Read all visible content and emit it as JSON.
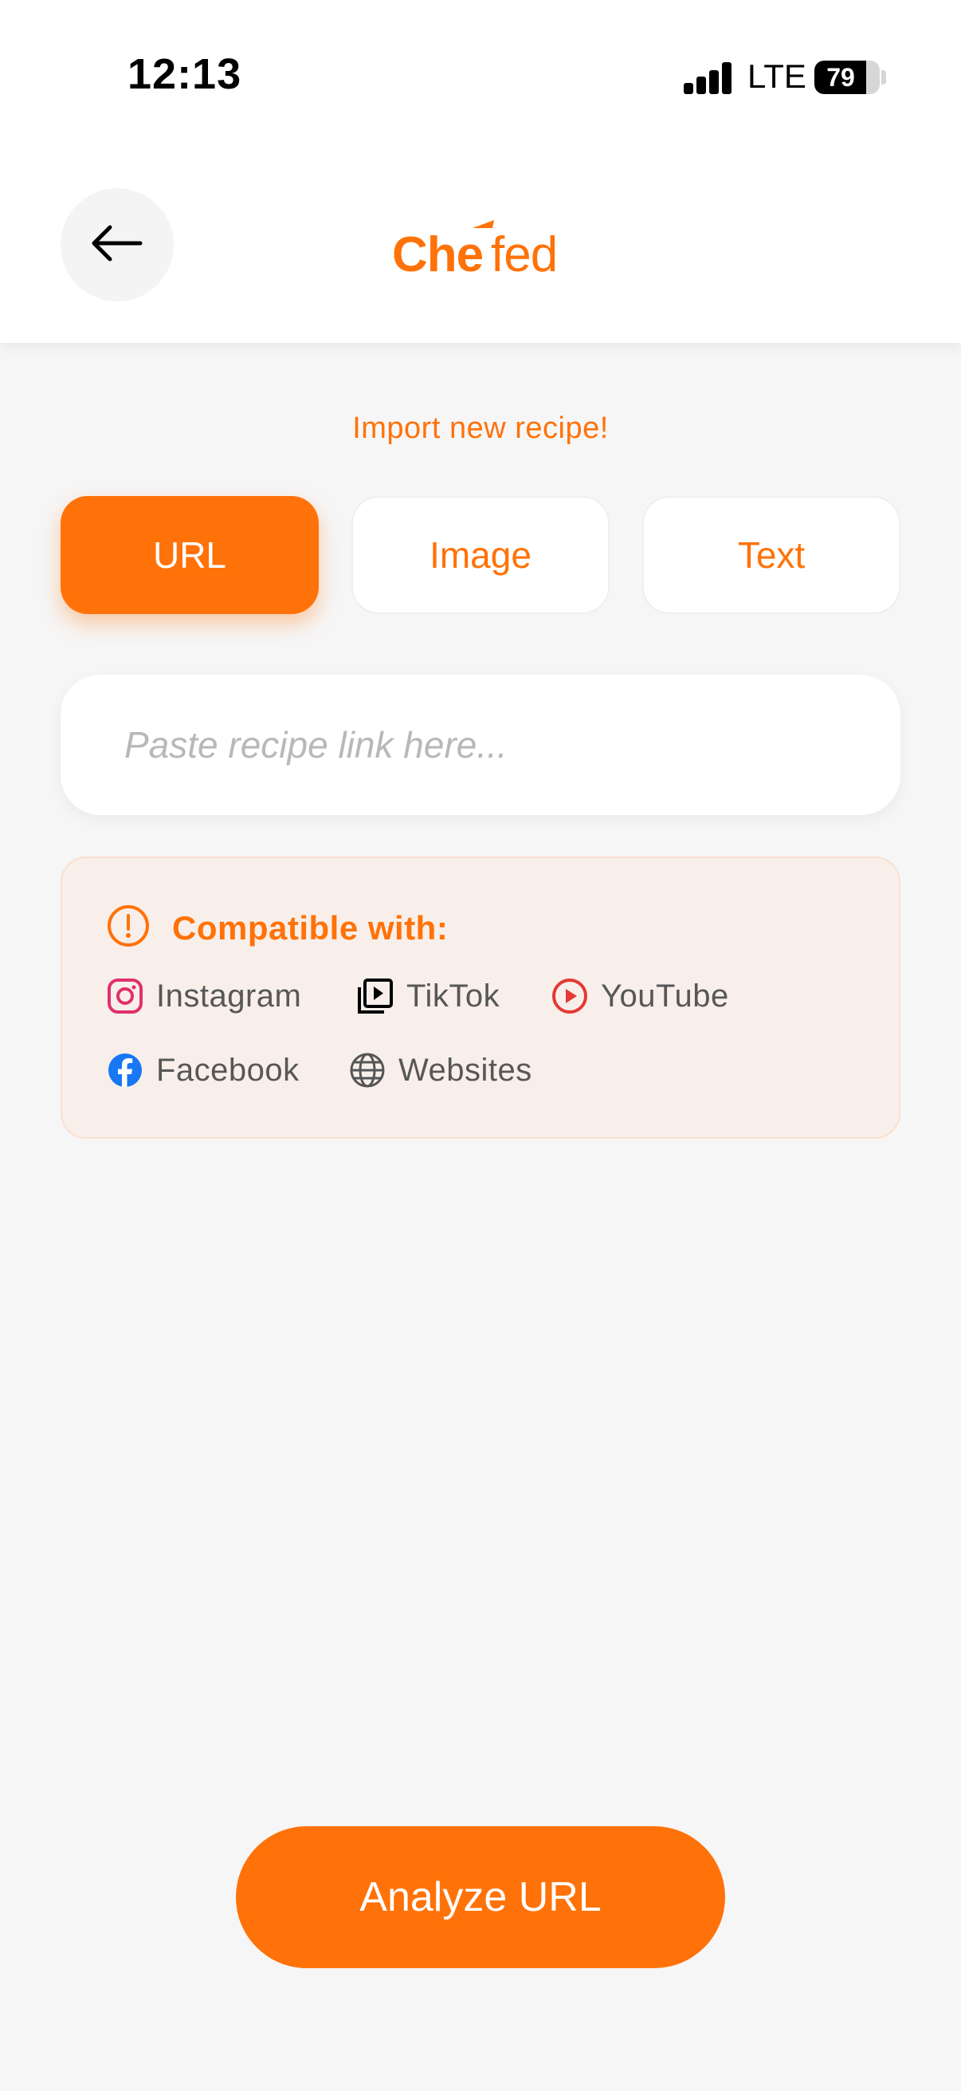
{
  "status_bar": {
    "time": "12:13",
    "network": "LTE",
    "battery": "79",
    "battery_level": 0.79
  },
  "header": {
    "logo_text": "Chefed",
    "back_icon": "arrow-left-icon"
  },
  "import": {
    "subtitle": "Import new recipe!",
    "tabs": [
      {
        "label": "URL",
        "active": true
      },
      {
        "label": "Image",
        "active": false
      },
      {
        "label": "Text",
        "active": false
      }
    ],
    "url_placeholder": "Paste recipe link here...",
    "url_value": ""
  },
  "compatibility": {
    "title": "Compatible with:",
    "icon": "info-circle-icon",
    "platforms": [
      {
        "label": "Instagram",
        "icon": "instagram-icon"
      },
      {
        "label": "TikTok",
        "icon": "tiktok-icon"
      },
      {
        "label": "YouTube",
        "icon": "youtube-icon"
      },
      {
        "label": "Facebook",
        "icon": "facebook-icon"
      },
      {
        "label": "Websites",
        "icon": "globe-icon"
      }
    ]
  },
  "actions": {
    "analyze_label": "Analyze URL"
  },
  "colors": {
    "accent": "#ff7209",
    "background": "#f6f6f6",
    "compat_bg": "#f8efea"
  }
}
